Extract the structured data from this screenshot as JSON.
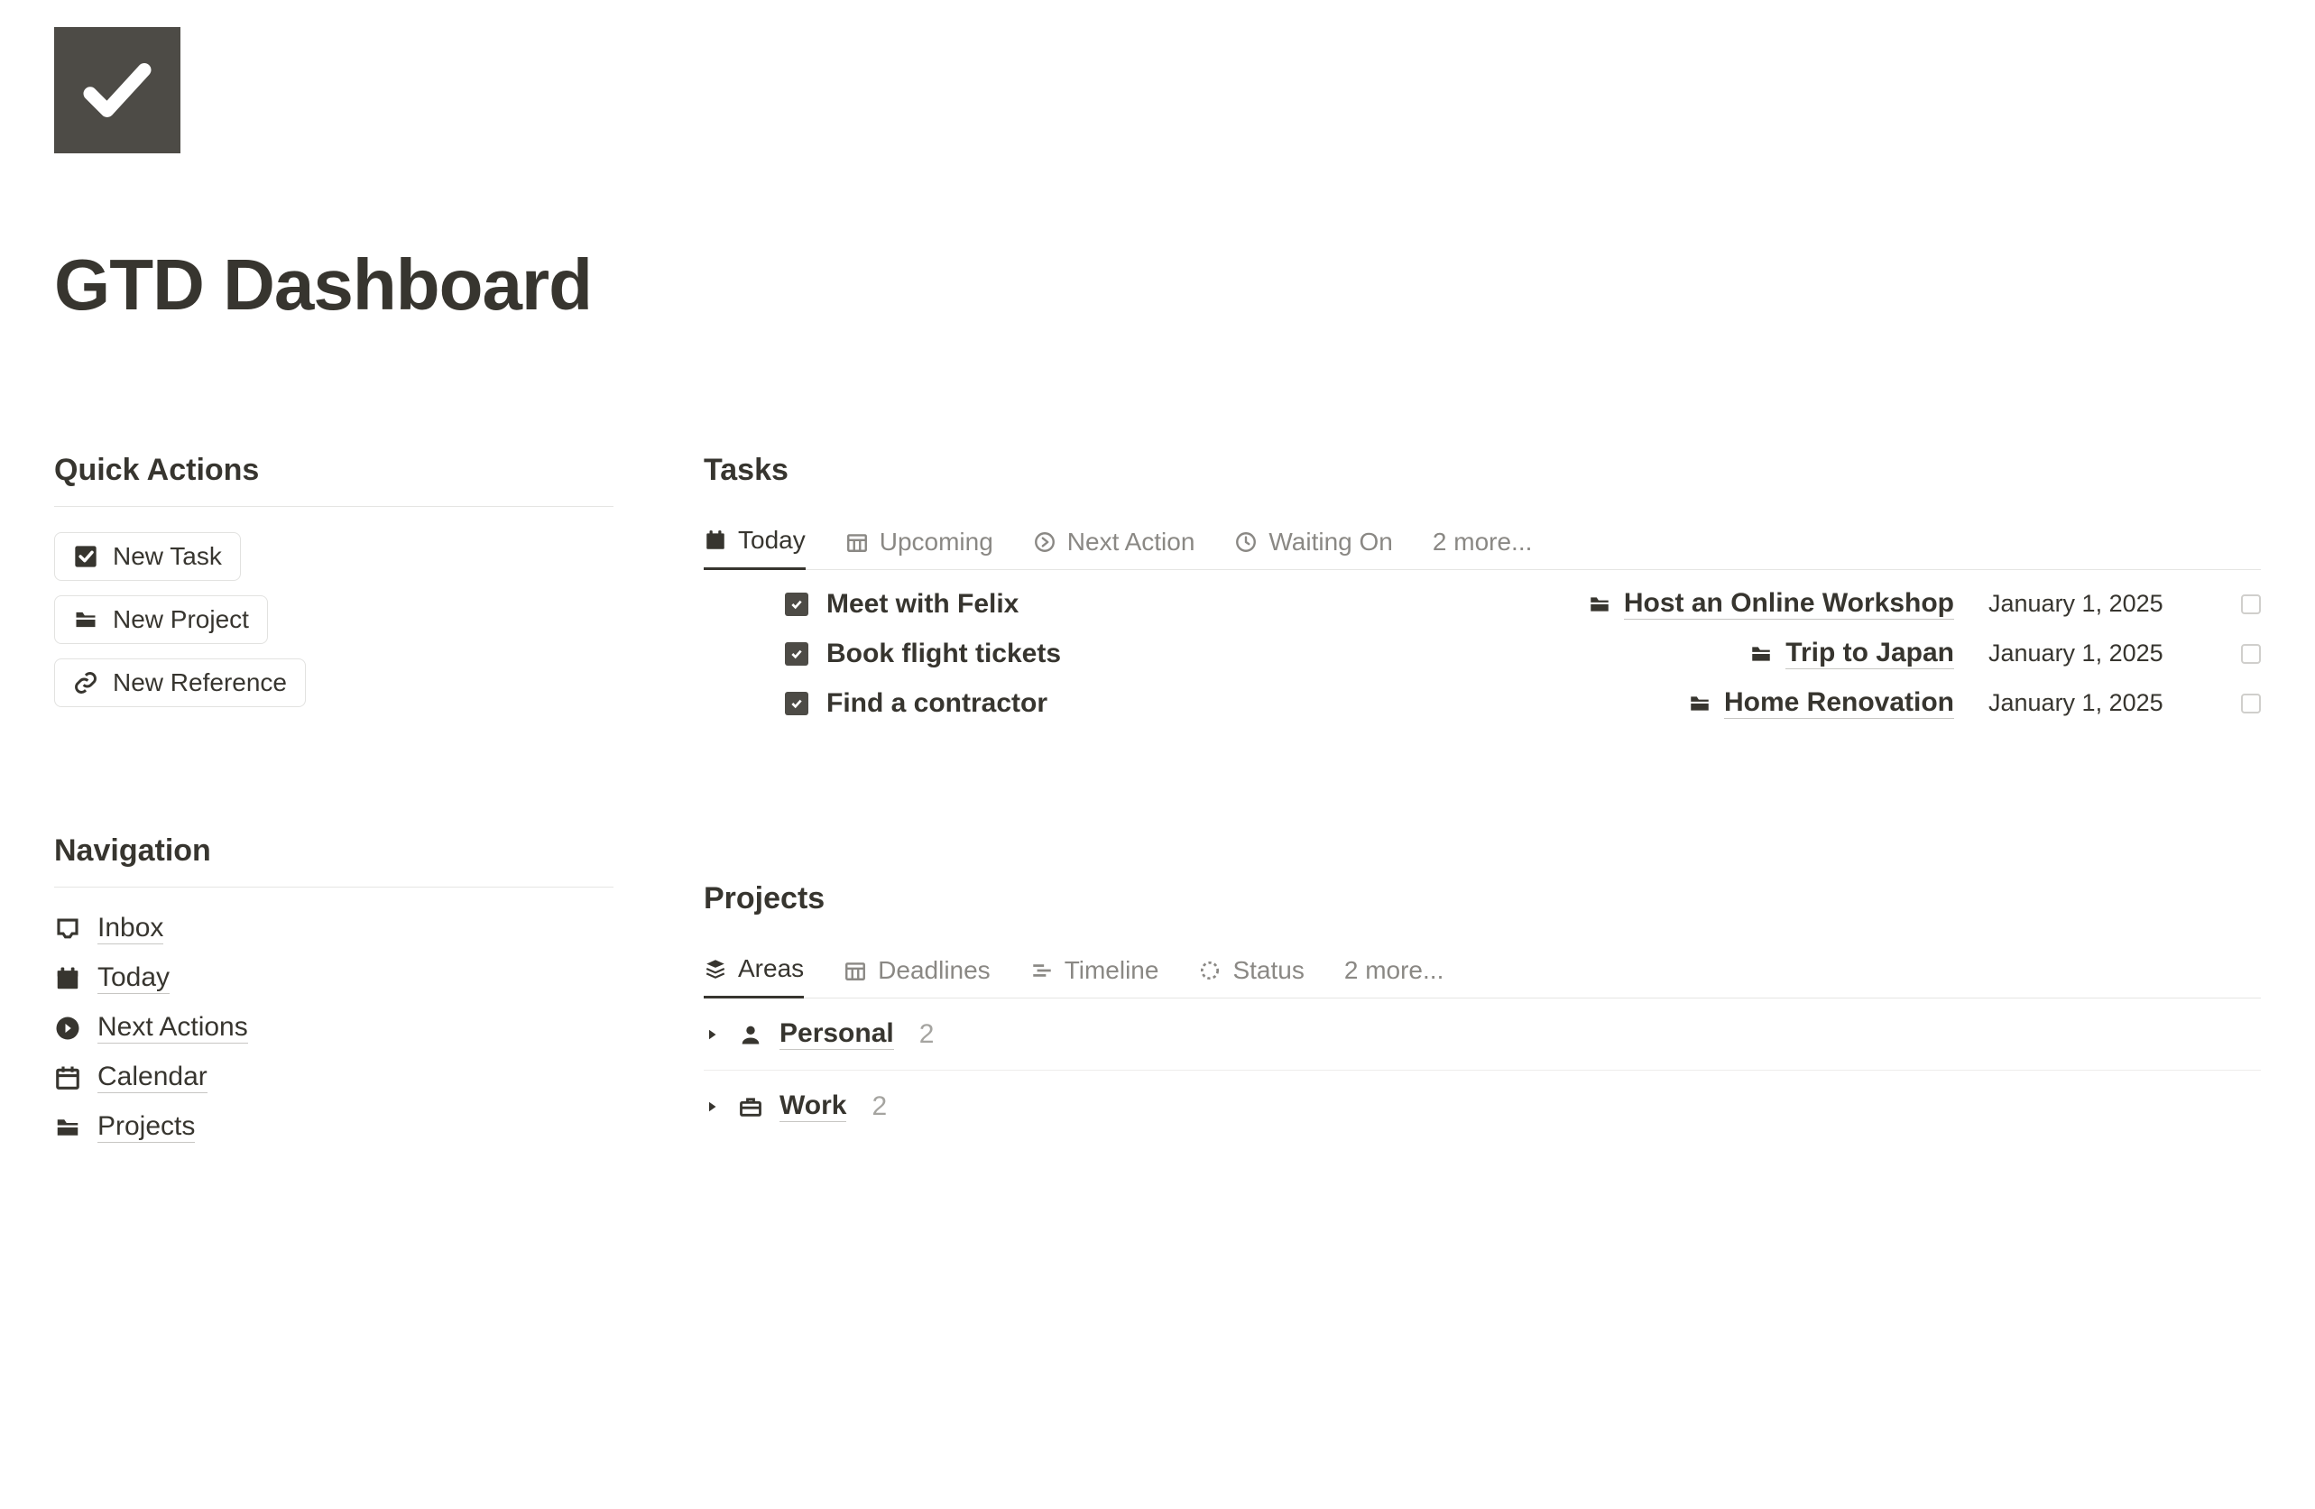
{
  "page": {
    "title": "GTD Dashboard"
  },
  "sidebar": {
    "quick_actions": {
      "heading": "Quick Actions",
      "buttons": [
        {
          "label": "New Task"
        },
        {
          "label": "New Project"
        },
        {
          "label": "New Reference"
        }
      ]
    },
    "navigation": {
      "heading": "Navigation",
      "items": [
        {
          "label": "Inbox"
        },
        {
          "label": "Today"
        },
        {
          "label": "Next Actions"
        },
        {
          "label": "Calendar"
        },
        {
          "label": "Projects"
        }
      ]
    }
  },
  "tasks": {
    "heading": "Tasks",
    "tabs": [
      {
        "label": "Today",
        "active": true
      },
      {
        "label": "Upcoming"
      },
      {
        "label": "Next Action"
      },
      {
        "label": "Waiting On"
      }
    ],
    "tabs_more": "2 more...",
    "rows": [
      {
        "title": "Meet with Felix",
        "project": "Host an Online Workshop",
        "date": "January 1, 2025"
      },
      {
        "title": "Book flight tickets",
        "project": "Trip to Japan",
        "date": "January 1, 2025"
      },
      {
        "title": "Find a contractor",
        "project": "Home Renovation",
        "date": "January 1, 2025"
      }
    ]
  },
  "projects": {
    "heading": "Projects",
    "tabs": [
      {
        "label": "Areas",
        "active": true
      },
      {
        "label": "Deadlines"
      },
      {
        "label": "Timeline"
      },
      {
        "label": "Status"
      }
    ],
    "tabs_more": "2 more...",
    "areas": [
      {
        "label": "Personal",
        "count": "2"
      },
      {
        "label": "Work",
        "count": "2"
      }
    ]
  }
}
